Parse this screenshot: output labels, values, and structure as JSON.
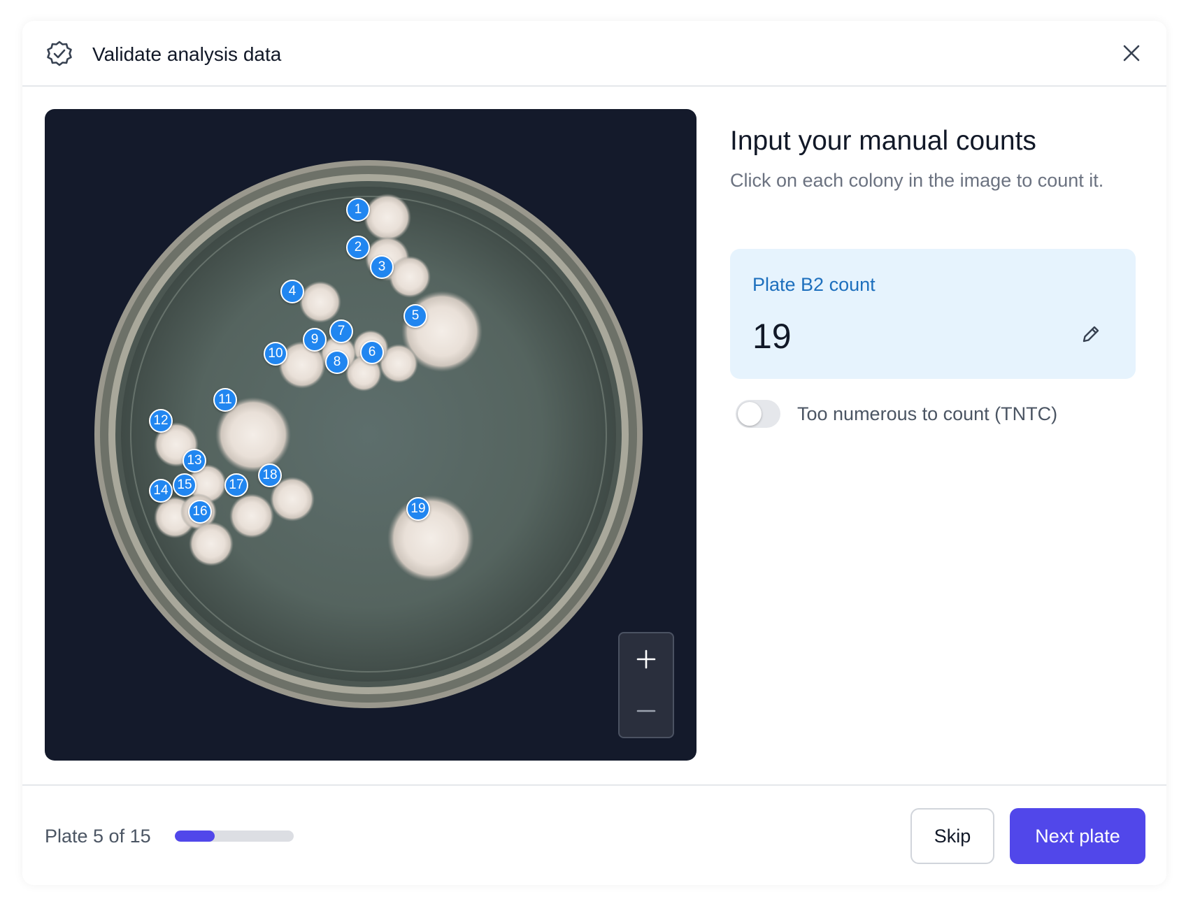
{
  "header": {
    "title": "Validate analysis data",
    "icon": "verified-badge-icon",
    "close_icon": "close-icon"
  },
  "viewer": {
    "background_color": "#141a2b",
    "marker_color": "#2186f0",
    "zoom_in_icon": "plus-icon",
    "zoom_out_icon": "minus-icon",
    "markers": [
      {
        "label": "1"
      },
      {
        "label": "2"
      },
      {
        "label": "3"
      },
      {
        "label": "4"
      },
      {
        "label": "5"
      },
      {
        "label": "6"
      },
      {
        "label": "7"
      },
      {
        "label": "8"
      },
      {
        "label": "9"
      },
      {
        "label": "10"
      },
      {
        "label": "11"
      },
      {
        "label": "12"
      },
      {
        "label": "13"
      },
      {
        "label": "14"
      },
      {
        "label": "15"
      },
      {
        "label": "16"
      },
      {
        "label": "17"
      },
      {
        "label": "18"
      },
      {
        "label": "19"
      }
    ]
  },
  "panel": {
    "title": "Input your manual counts",
    "subtitle": "Click on each colony in the image to count it.",
    "count_card": {
      "label": "Plate B2 count",
      "value": "19",
      "edit_icon": "pencil-icon",
      "background_color": "#e6f3fd"
    },
    "tntc": {
      "label": "Too numerous to count (TNTC)",
      "enabled": false
    }
  },
  "footer": {
    "progress_text": "Plate 5 of 15",
    "progress_fraction": 0.333,
    "skip_label": "Skip",
    "next_label": "Next plate",
    "accent_color": "#5147ea"
  }
}
